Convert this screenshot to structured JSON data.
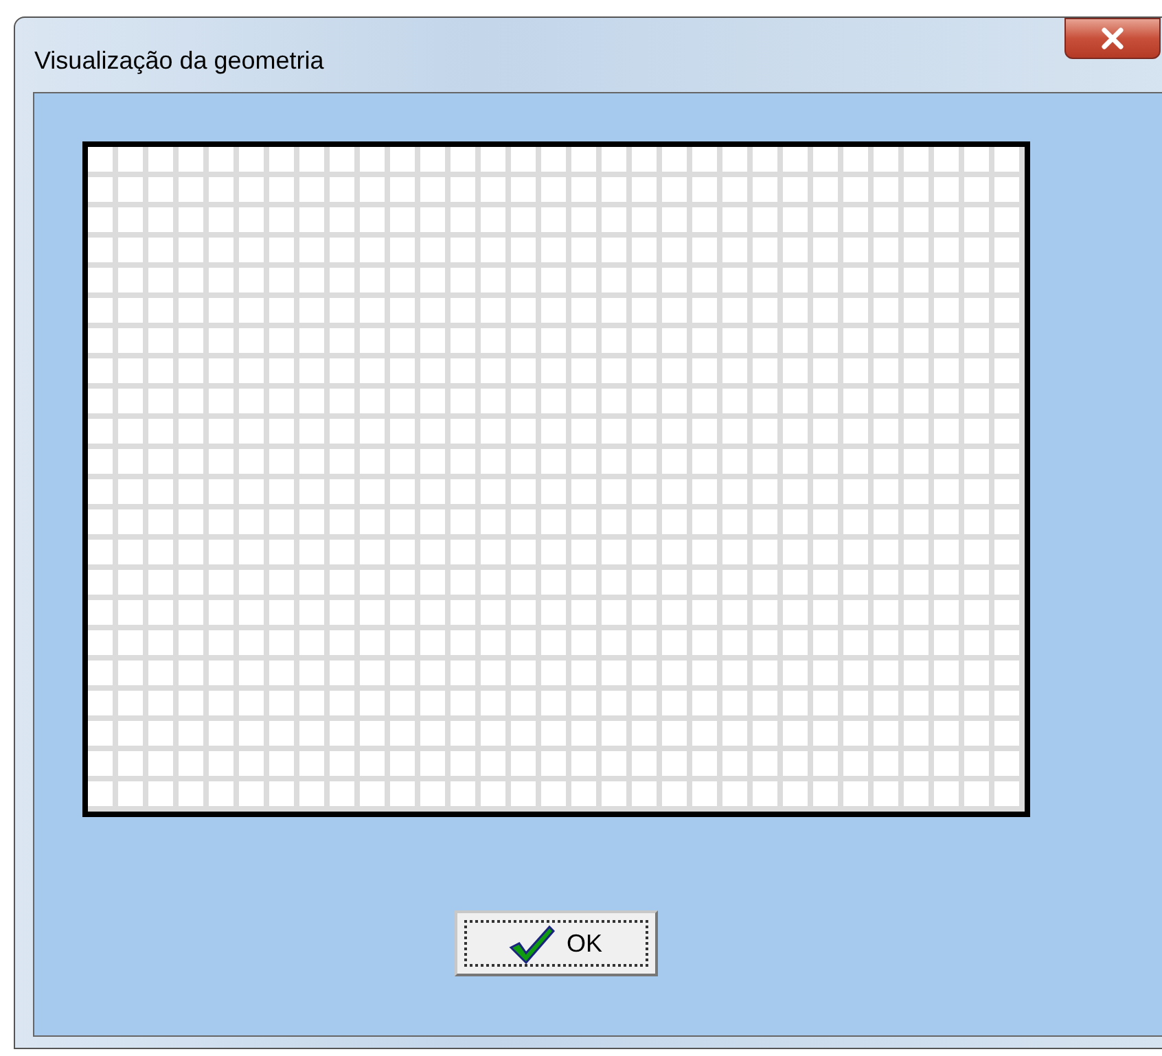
{
  "window": {
    "title": "Visualização da geometria"
  },
  "buttons": [
    {
      "label": "OK",
      "kind": "ok"
    }
  ]
}
